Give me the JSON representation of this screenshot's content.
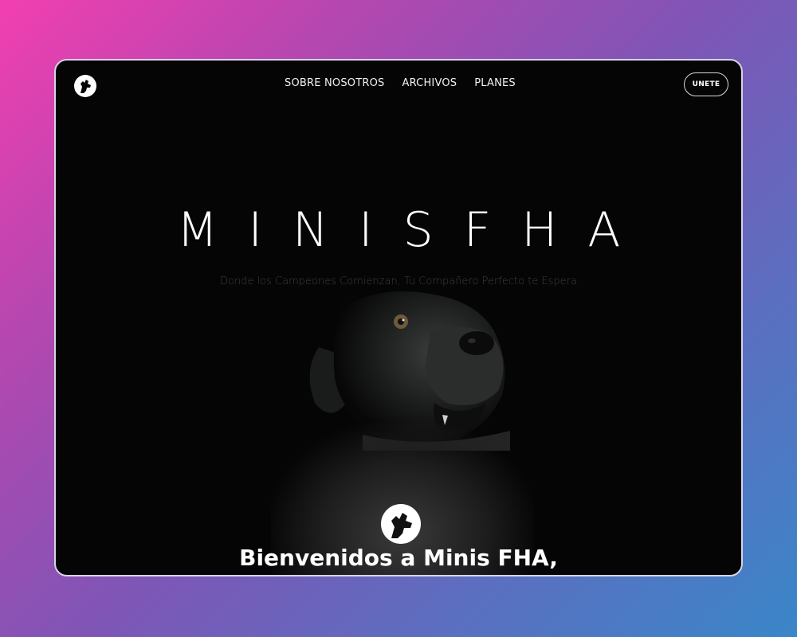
{
  "nav": {
    "logo_icon": "dog-head-logo-icon",
    "links": [
      "SOBRE NOSOTROS",
      "ARCHIVOS",
      "PLANES"
    ],
    "join_label": "UNETE"
  },
  "hero": {
    "title": "MINISFHA",
    "subtitle": "Donde los Campeones Comienzan, Tu Compañero Perfecto te Espera",
    "image_icon": "black-dog-portrait"
  },
  "welcome": {
    "logo_icon": "dog-head-logo-icon",
    "title": "Bienvenidos a Minis FHA,"
  },
  "colors": {
    "frame_bg": "#050505",
    "text": "#ffffff",
    "subtitle": "#3e3e3e",
    "bg_gradient_start": "#f23fb0",
    "bg_gradient_end": "#3a86c8"
  }
}
